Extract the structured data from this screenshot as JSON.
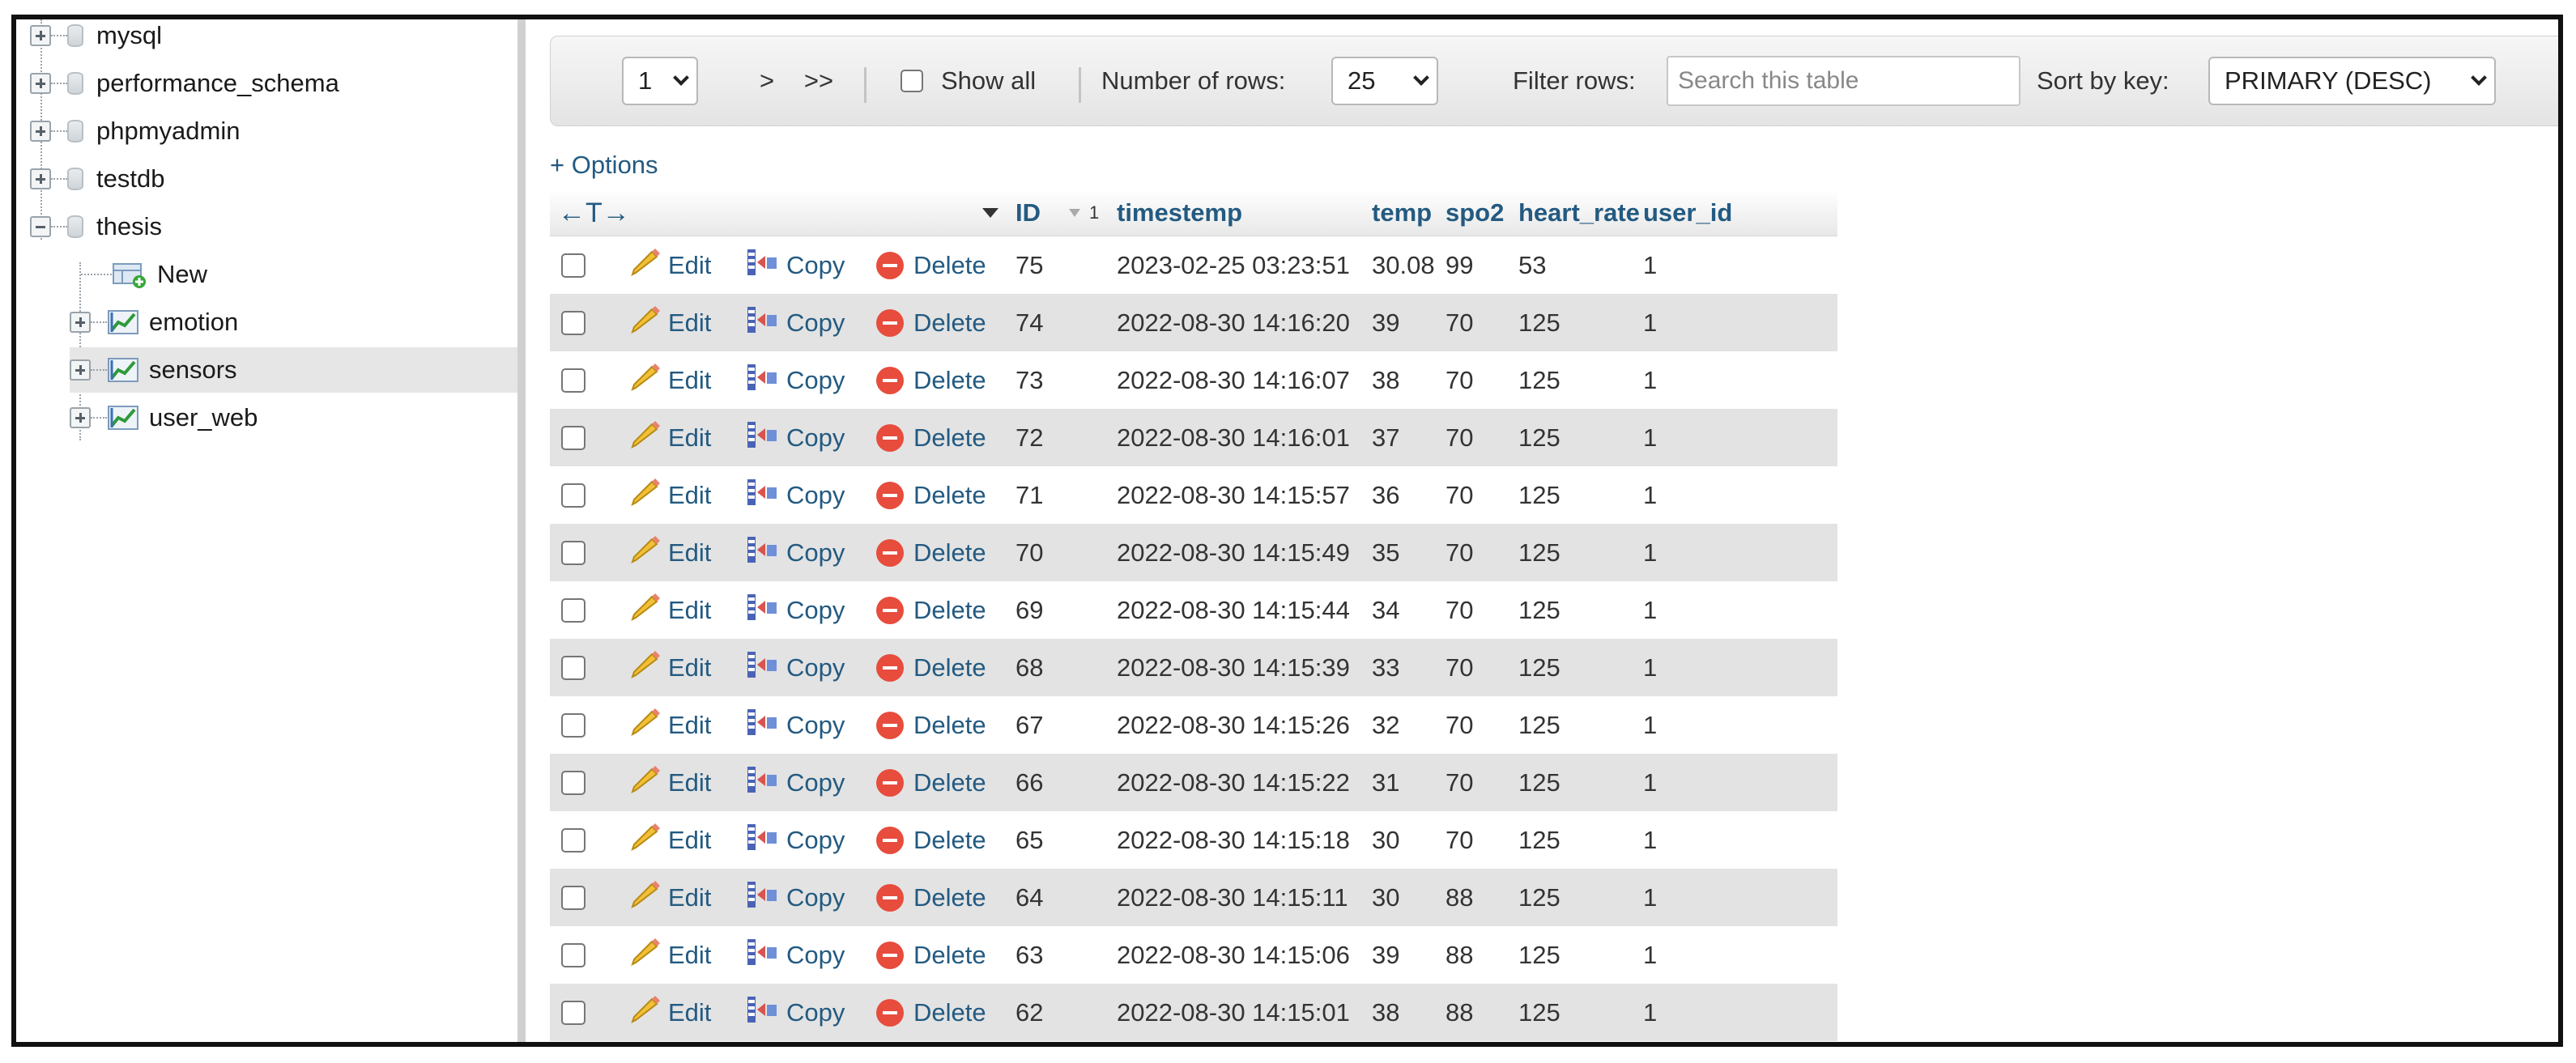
{
  "sidebar": {
    "databases": [
      "mysql",
      "performance_schema",
      "phpmyadmin",
      "testdb",
      "thesis"
    ],
    "thesis_children": [
      {
        "label": "New",
        "type": "new"
      },
      {
        "label": "emotion",
        "type": "table"
      },
      {
        "label": "sensors",
        "type": "table",
        "selected": true
      },
      {
        "label": "user_web",
        "type": "table"
      }
    ]
  },
  "navbar": {
    "page_select": "1",
    "next_label": ">",
    "last_label": ">>",
    "show_all_label": "Show all",
    "rows_label": "Number of rows:",
    "rows_select": "25",
    "filter_label": "Filter rows:",
    "filter_placeholder": "Search this table",
    "sort_label": "Sort by key:",
    "sort_select": "PRIMARY (DESC)"
  },
  "options_link": "+ Options",
  "table": {
    "arrows": "←T→",
    "sort_index": "1",
    "columns": [
      "ID",
      "timestemp",
      "temp",
      "spo2",
      "heart_rate",
      "user_id"
    ],
    "action_labels": {
      "edit": "Edit",
      "copy": "Copy",
      "delete": "Delete"
    },
    "rows": [
      [
        "75",
        "2023-02-25 03:23:51",
        "30.08",
        "99",
        "53",
        "1"
      ],
      [
        "74",
        "2022-08-30 14:16:20",
        "39",
        "70",
        "125",
        "1"
      ],
      [
        "73",
        "2022-08-30 14:16:07",
        "38",
        "70",
        "125",
        "1"
      ],
      [
        "72",
        "2022-08-30 14:16:01",
        "37",
        "70",
        "125",
        "1"
      ],
      [
        "71",
        "2022-08-30 14:15:57",
        "36",
        "70",
        "125",
        "1"
      ],
      [
        "70",
        "2022-08-30 14:15:49",
        "35",
        "70",
        "125",
        "1"
      ],
      [
        "69",
        "2022-08-30 14:15:44",
        "34",
        "70",
        "125",
        "1"
      ],
      [
        "68",
        "2022-08-30 14:15:39",
        "33",
        "70",
        "125",
        "1"
      ],
      [
        "67",
        "2022-08-30 14:15:26",
        "32",
        "70",
        "125",
        "1"
      ],
      [
        "66",
        "2022-08-30 14:15:22",
        "31",
        "70",
        "125",
        "1"
      ],
      [
        "65",
        "2022-08-30 14:15:18",
        "30",
        "70",
        "125",
        "1"
      ],
      [
        "64",
        "2022-08-30 14:15:11",
        "30",
        "88",
        "125",
        "1"
      ],
      [
        "63",
        "2022-08-30 14:15:06",
        "39",
        "88",
        "125",
        "1"
      ],
      [
        "62",
        "2022-08-30 14:15:01",
        "38",
        "88",
        "125",
        "1"
      ]
    ]
  },
  "colors": {
    "link": "#235a81",
    "row_alt": "#e3e3e3",
    "delete": "#e74c3c"
  }
}
